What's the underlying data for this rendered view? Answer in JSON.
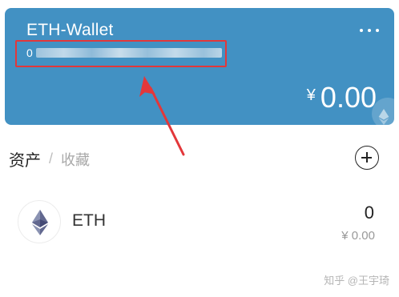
{
  "wallet": {
    "name": "ETH-Wallet",
    "address_visible_prefix": "0",
    "balance_currency": "¥",
    "balance_value": "0.00",
    "more_icon": "more-horizontal-icon",
    "card_color": "#4291c3"
  },
  "tabs": {
    "assets": "资产",
    "separator": "/",
    "favorites": "收藏"
  },
  "tokens": [
    {
      "symbol": "ETH",
      "amount": "0",
      "value": "¥ 0.00",
      "icon": "ethereum-icon"
    }
  ],
  "annotation": {
    "highlight_color": "#e3373a"
  },
  "watermark": "知乎 @王宇琦"
}
